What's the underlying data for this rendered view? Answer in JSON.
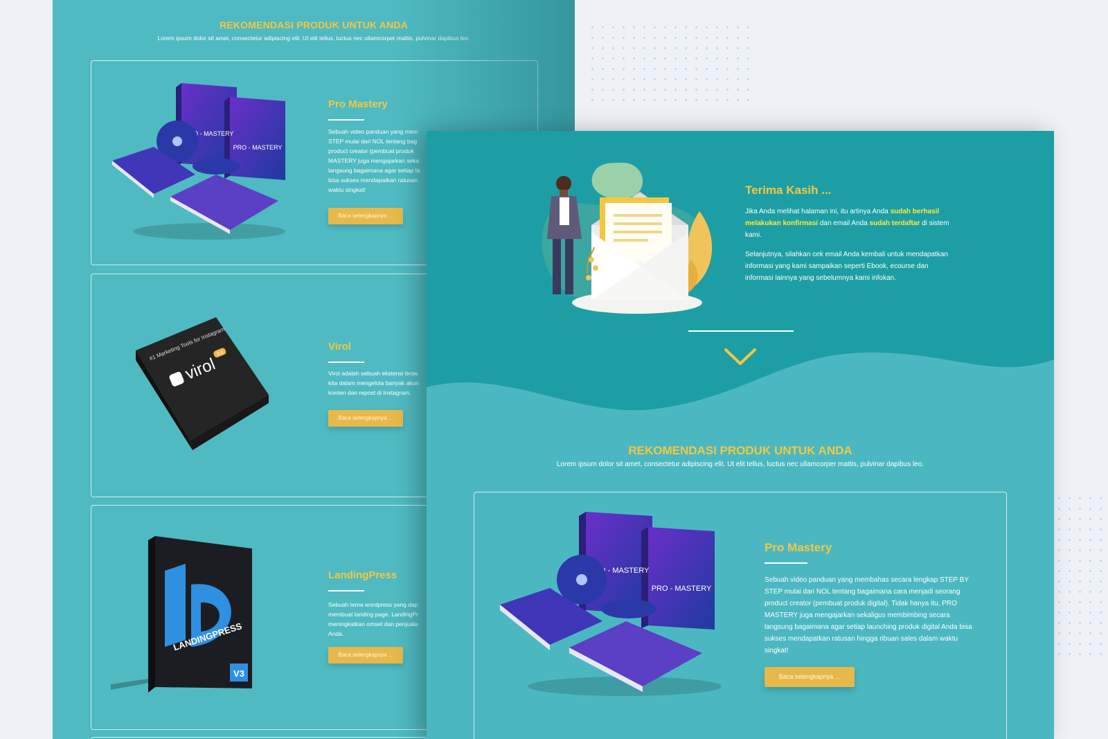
{
  "back_page": {
    "section_title": "REKOMENDASI PRODUK UNTUK ANDA",
    "section_subtitle": "Lorem ipsum dolor sit amet, consectetur adipiscing elit. Ut elit tellus, luctus nec ullamcorper mattis, pulvinar dapibus leo.",
    "products": [
      {
        "name": "Pro Mastery",
        "desc_lines": [
          "Sebuah video panduan yang mem",
          "STEP mulai dari NOL tentang bag",
          "product creator (pembuat produk",
          "MASTERY juga mengajarkan seka",
          "langsung bagaimana agar setiap la",
          "bisa sukses mendapatkan ratusan",
          "waktu singkat!"
        ],
        "button": "Baca selengkapnya ..."
      },
      {
        "name": "Virol",
        "desc_lines": [
          "Virol adalah sebuah ekstensi brow",
          "kita dalam mengelola banyak akun",
          "konten dan repost di Instagram."
        ],
        "button": "Baca selengkapnya ..."
      },
      {
        "name": "LandingPress",
        "desc_lines": [
          "Sebuah tema wordpress yang dap",
          "membuat landing page. LandingPr",
          "meningkatkan omset dan penjuala",
          "Anda."
        ],
        "button": "Baca selengkapnya ..."
      }
    ],
    "box_labels": {
      "pro_mastery": "PRO - MASTERY",
      "virol_tag": "#1 Marketing Tools for Instagram",
      "virol_brand": "virol",
      "virol_version": "3.0",
      "landingpress": "LANDINGPRESS",
      "landingpress_version": "V3"
    }
  },
  "front_page": {
    "thanks": {
      "title": "Terima Kasih ...",
      "p1_a": "Jika Anda melihat halaman ini, itu artinya Anda ",
      "p1_hl1": "sudah berhasil melakukan konfirmasi",
      "p1_b": " dan email Anda ",
      "p1_hl2": "sudah terdaftar",
      "p1_c": " di sistem kami.",
      "p2": "Selanjutnya, silahkan cek email Anda kembali untuk mendapatkan informasi yang kami sampaikan seperti Ebook, ecourse dan informasi lainnya yang sebelumnya kami infokan."
    },
    "section_title": "REKOMENDASI PRODUK UNTUK ANDA",
    "section_subtitle": "Lorem ipsum dolor sit amet, consectetur adipiscing elit. Ut elit tellus, luctus nec ullamcorper mattis, pulvinar dapibus leo.",
    "product": {
      "name": "Pro Mastery",
      "desc": "Sebuah video panduan yang membahas secara lengkap STEP BY STEP mulai dari NOL tentang bagaimana cara menjadi seorang product creator (pembuat produk digital). Tidak hanya itu, PRO MASTERY juga mengajarkan sekaligus membimbing secara langsung bagaimana agar setiap launching produk digital Anda bisa sukses mendapatkan ratusan hingga ribuan sales dalam waktu singkat!",
      "button": "Baca selengkapnya ...",
      "box_label": "PRO - MASTERY"
    }
  },
  "colors": {
    "teal": "#4fbac1",
    "teal_dark": "#1d9ea5",
    "accent_yellow": "#f5c740",
    "button_gold": "#e8b84a",
    "highlight": "#ffe93a"
  }
}
